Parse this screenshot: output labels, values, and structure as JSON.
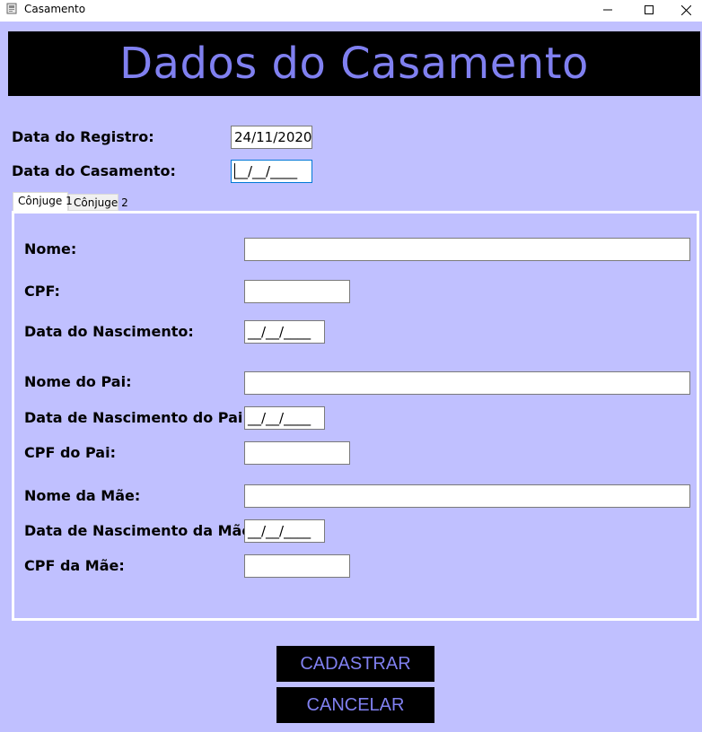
{
  "window": {
    "title": "Casamento",
    "app_icon": "app-icon",
    "controls": {
      "minimize": "─",
      "maximize": "☐",
      "close": "✕"
    }
  },
  "header": {
    "title": "Dados do Casamento"
  },
  "registro": {
    "data_registro_label": "Data do Registro:",
    "data_registro_value": "24/11/2020",
    "data_casamento_label": "Data do Casamento:",
    "data_casamento_value": "__/__/____"
  },
  "tabs": [
    {
      "label": "Cônjuge 1",
      "active": true
    },
    {
      "label": "Cônjuge 2",
      "active": false
    }
  ],
  "conjuge_form": {
    "nome_label": "Nome:",
    "nome_value": "",
    "cpf_label": "CPF:",
    "cpf_value": "",
    "nascimento_label": "Data do Nascimento:",
    "nascimento_value": "__/__/____",
    "nome_pai_label": "Nome do Pai:",
    "nome_pai_value": "",
    "nascimento_pai_label": "Data de Nascimento do Pai:",
    "nascimento_pai_value": "__/__/____",
    "cpf_pai_label": "CPF do Pai:",
    "cpf_pai_value": "",
    "nome_mae_label": "Nome da Mãe:",
    "nome_mae_value": "",
    "nascimento_mae_label": "Data de Nascimento da Mãe:",
    "nascimento_mae_value": "__/__/____",
    "cpf_mae_label": "CPF da Mãe:",
    "cpf_mae_value": ""
  },
  "actions": {
    "cadastrar_label": "CADASTRAR",
    "cancelar_label": "CANCELAR"
  },
  "colors": {
    "background": "#c0c0ff",
    "banner": "#000000",
    "accent": "#8080f0"
  }
}
